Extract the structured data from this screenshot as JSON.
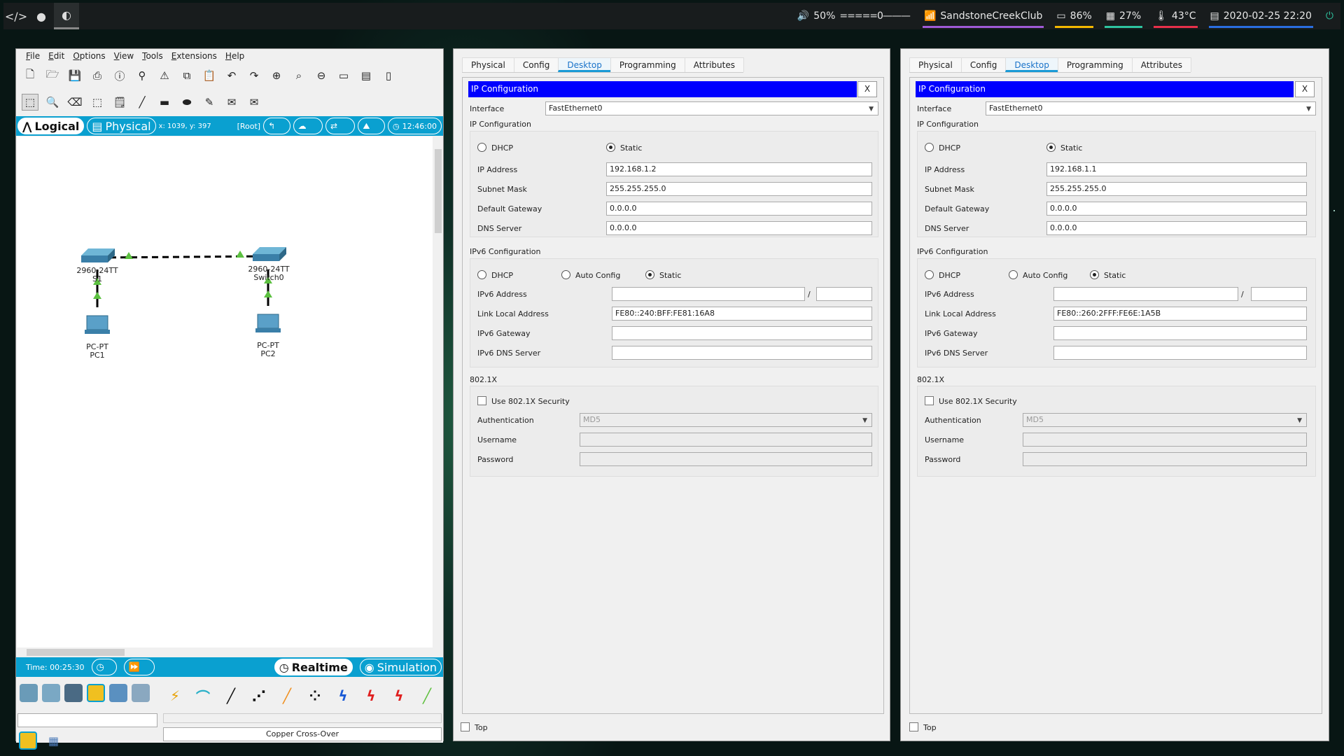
{
  "topbar": {
    "workspaces": [
      "</>",
      "●",
      "◐"
    ],
    "volume": "50%",
    "volume_bar": "=====0———",
    "wifi": "SandstoneCreekClub",
    "battery": "86%",
    "memory": "27%",
    "temp": "43°C",
    "datetime": "2020-02-25 22:20",
    "colors": {
      "wifi": "#a05ad6",
      "battery": "#f5b800",
      "memory": "#2ec4a0",
      "temp": "#e8304a",
      "date": "#2a6ee0"
    }
  },
  "pt": {
    "menu": [
      "File",
      "Edit",
      "Options",
      "View",
      "Tools",
      "Extensions",
      "Help"
    ],
    "logical": "Logical",
    "physical": "Physical",
    "coords": "x: 1039, y: 397",
    "root": "[Root]",
    "clock": "12:46:00",
    "time": "Time: 00:25:30",
    "realtime": "Realtime",
    "simulation": "Simulation",
    "cable_name": "Copper Cross-Over",
    "nodes": {
      "s1_model": "2960-24TT",
      "s1_name": "S1",
      "sw0_model": "2960-24TT",
      "sw0_name": "Switch0",
      "pc1_model": "PC-PT",
      "pc1_name": "PC1",
      "pc2_model": "PC-PT",
      "pc2_name": "PC2"
    }
  },
  "cfg1": {
    "tabs": [
      "Physical",
      "Config",
      "Desktop",
      "Programming",
      "Attributes"
    ],
    "title": "IP Configuration",
    "close": "X",
    "interface_label": "Interface",
    "interface": "FastEthernet0",
    "ipv4_header": "IP Configuration",
    "dhcp": "DHCP",
    "static": "Static",
    "ip_label": "IP Address",
    "ip": "192.168.1.2",
    "mask_label": "Subnet Mask",
    "mask": "255.255.255.0",
    "gw_label": "Default Gateway",
    "gw": "0.0.0.0",
    "dns_label": "DNS Server",
    "dns": "0.0.0.0",
    "ipv6_header": "IPv6 Configuration",
    "auto": "Auto Config",
    "ipv6_label": "IPv6 Address",
    "slash": "/",
    "lla_label": "Link Local Address",
    "lla": "FE80::240:BFF:FE81:16A8",
    "v6gw_label": "IPv6 Gateway",
    "v6dns_label": "IPv6 DNS Server",
    "dot1x_header": "802.1X",
    "use_dot1x": "Use 802.1X Security",
    "auth_label": "Authentication",
    "auth": "MD5",
    "user_label": "Username",
    "pass_label": "Password",
    "top": "Top"
  },
  "cfg2": {
    "tabs": [
      "Physical",
      "Config",
      "Desktop",
      "Programming",
      "Attributes"
    ],
    "title": "IP Configuration",
    "close": "X",
    "interface_label": "Interface",
    "interface": "FastEthernet0",
    "ipv4_header": "IP Configuration",
    "dhcp": "DHCP",
    "static": "Static",
    "ip_label": "IP Address",
    "ip": "192.168.1.1",
    "mask_label": "Subnet Mask",
    "mask": "255.255.255.0",
    "gw_label": "Default Gateway",
    "gw": "0.0.0.0",
    "dns_label": "DNS Server",
    "dns": "0.0.0.0",
    "ipv6_header": "IPv6 Configuration",
    "auto": "Auto Config",
    "ipv6_label": "IPv6 Address",
    "slash": "/",
    "lla_label": "Link Local Address",
    "lla": "FE80::260:2FFF:FE6E:1A5B",
    "v6gw_label": "IPv6 Gateway",
    "v6dns_label": "IPv6 DNS Server",
    "dot1x_header": "802.1X",
    "use_dot1x": "Use 802.1X Security",
    "auth_label": "Authentication",
    "auth": "MD5",
    "user_label": "Username",
    "pass_label": "Password",
    "top": "Top"
  }
}
